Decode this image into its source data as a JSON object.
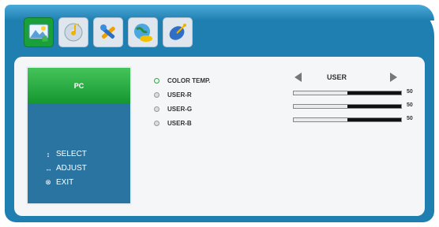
{
  "tabs": [
    {
      "icon": "picture-icon",
      "active": true
    },
    {
      "icon": "audio-cd-icon",
      "active": false
    },
    {
      "icon": "setup-tools-icon",
      "active": false
    },
    {
      "icon": "globe-clock-icon",
      "active": false
    },
    {
      "icon": "satellite-dish-icon",
      "active": false
    }
  ],
  "sidebar": {
    "selected_label": "PC",
    "help": [
      {
        "symbol": "↕",
        "label": "SELECT"
      },
      {
        "symbol": "↔",
        "label": "ADJUST"
      },
      {
        "symbol": "⊗",
        "label": "EXIT"
      }
    ]
  },
  "menu": {
    "items": [
      {
        "label": "COLOR TEMP.",
        "selected": true
      },
      {
        "label": "USER-R",
        "selected": false
      },
      {
        "label": "USER-G",
        "selected": false
      },
      {
        "label": "USER-B",
        "selected": false
      }
    ],
    "color_temp_value": "USER",
    "sliders": [
      {
        "label": "USER-R",
        "value": 50,
        "max": 100
      },
      {
        "label": "USER-G",
        "value": 50,
        "max": 100
      },
      {
        "label": "USER-B",
        "value": 50,
        "max": 100
      }
    ]
  },
  "colors": {
    "frame_blue": "#1f7fb0",
    "active_green": "#1aa03a",
    "sidebar_blue": "#2a74a2"
  }
}
